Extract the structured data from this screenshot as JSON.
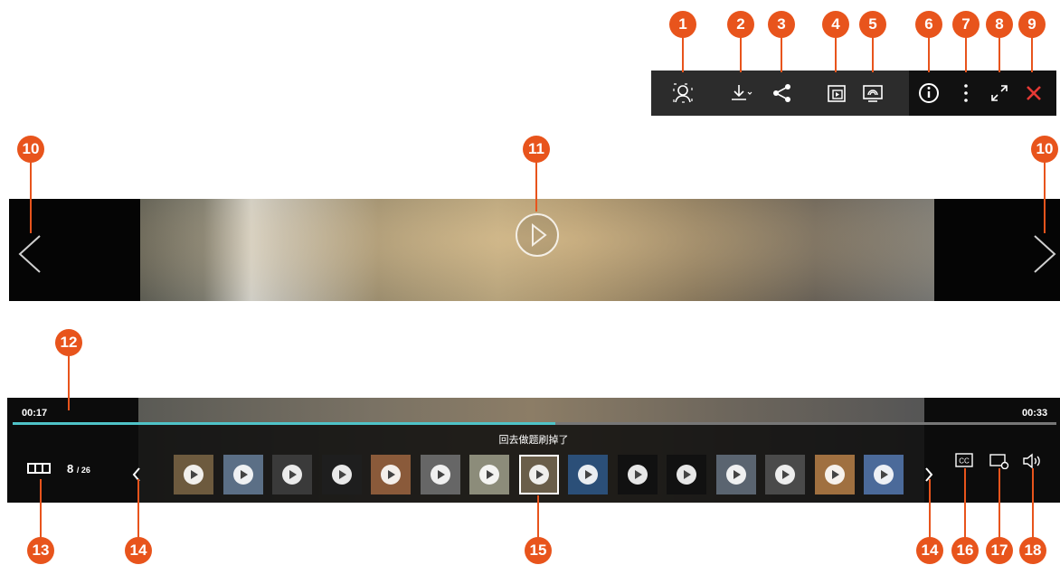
{
  "badges": {
    "b1": "1",
    "b2": "2",
    "b3": "3",
    "b4": "4",
    "b5": "5",
    "b6": "6",
    "b7": "7",
    "b8": "8",
    "b9": "9",
    "b10": "10",
    "b11": "11",
    "b12": "12",
    "b13": "13",
    "b14": "14",
    "b15": "15",
    "b16": "16",
    "b17": "17",
    "b18": "18"
  },
  "toolbar": {
    "icons": [
      "user-tag-icon",
      "download-icon",
      "share-icon",
      "picture-in-picture-icon",
      "cast-icon",
      "info-icon",
      "more-icon",
      "fullscreen-icon",
      "close-icon"
    ],
    "close_color": "#e53935"
  },
  "player": {
    "current_time": "00:17",
    "total_time": "00:33",
    "progress": 0.52,
    "subtitle": "回去做题刷掉了",
    "counter_current": "8",
    "counter_total": "/ 26",
    "accent": "#4fc3c8"
  },
  "thumbnails": [
    {
      "color": "#6d5a3e"
    },
    {
      "color": "#5b6f86"
    },
    {
      "color": "#3a3a3a"
    },
    {
      "color": "#1e1e1e"
    },
    {
      "color": "#8a5a3a"
    },
    {
      "color": "#666"
    },
    {
      "color": "#8c8c7a"
    },
    {
      "color": "#6a5e4a",
      "selected": true
    },
    {
      "color": "#2b4f78"
    },
    {
      "color": "#111"
    },
    {
      "color": "#111"
    },
    {
      "color": "#5a6470"
    },
    {
      "color": "#4a4a4a"
    },
    {
      "color": "#a07040"
    },
    {
      "color": "#4b6a9a"
    }
  ],
  "badge_color": "#e8541c"
}
